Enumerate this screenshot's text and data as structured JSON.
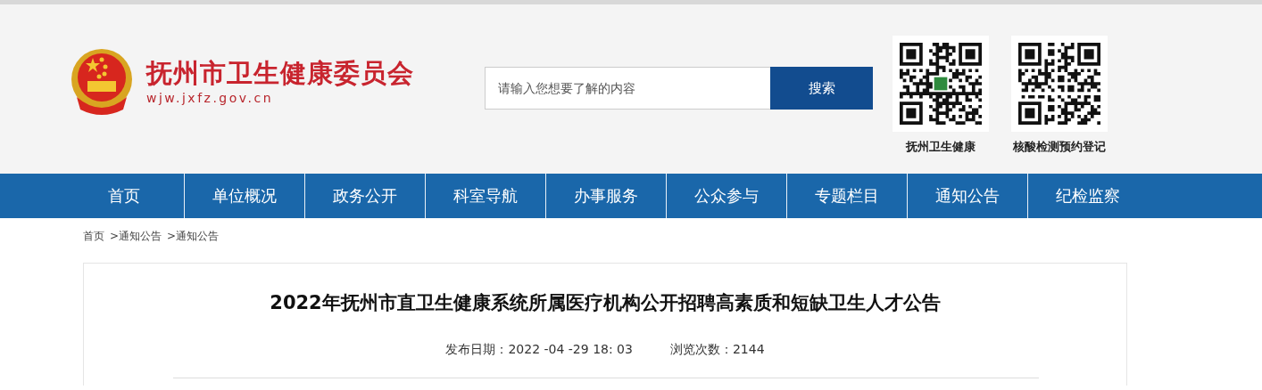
{
  "site": {
    "title": "抚州市卫生健康委员会",
    "url": "wjw.jxfz.gov.cn"
  },
  "search": {
    "placeholder": "请输入您想要了解的内容",
    "button": "搜索"
  },
  "qr_codes": [
    {
      "label": "抚州卫生健康"
    },
    {
      "label": "核酸检测预约登记"
    }
  ],
  "nav": [
    {
      "label": "首页"
    },
    {
      "label": "单位概况"
    },
    {
      "label": "政务公开"
    },
    {
      "label": "科室导航"
    },
    {
      "label": "办事服务"
    },
    {
      "label": "公众参与"
    },
    {
      "label": "专题栏目"
    },
    {
      "label": "通知公告"
    },
    {
      "label": "纪检监察"
    }
  ],
  "breadcrumb": [
    "首页",
    ">通知公告",
    ">通知公告"
  ],
  "article": {
    "title": "2022年抚州市直卫生健康系统所属医疗机构公开招聘高素质和短缺卫生人才公告",
    "date_label": "发布日期：",
    "date": "2022 -04 -29 18: 03",
    "views_label": "浏览次数：",
    "views": "2144"
  }
}
